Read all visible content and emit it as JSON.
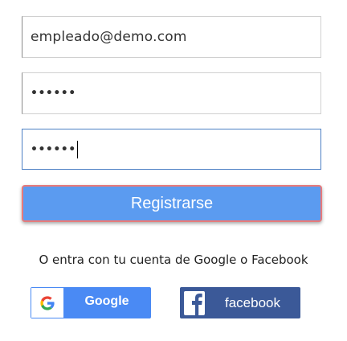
{
  "form": {
    "email_value": "empleado@demo.com",
    "password_value": "••••••",
    "confirm_value": "••••••"
  },
  "register_button": {
    "label": "Registrarse"
  },
  "alt_login": {
    "text": "O entra con tu cuenta de Google o Facebook",
    "google_label": "Google",
    "facebook_label": "facebook"
  },
  "colors": {
    "register_bg": "#5b9bf0",
    "register_border": "#e87a7a",
    "google_blue": "#4a8af4",
    "facebook_blue": "#3b5998",
    "focus_border": "#4c7fc4"
  },
  "icons": {
    "google": "google-g-icon",
    "facebook": "facebook-f-icon"
  }
}
